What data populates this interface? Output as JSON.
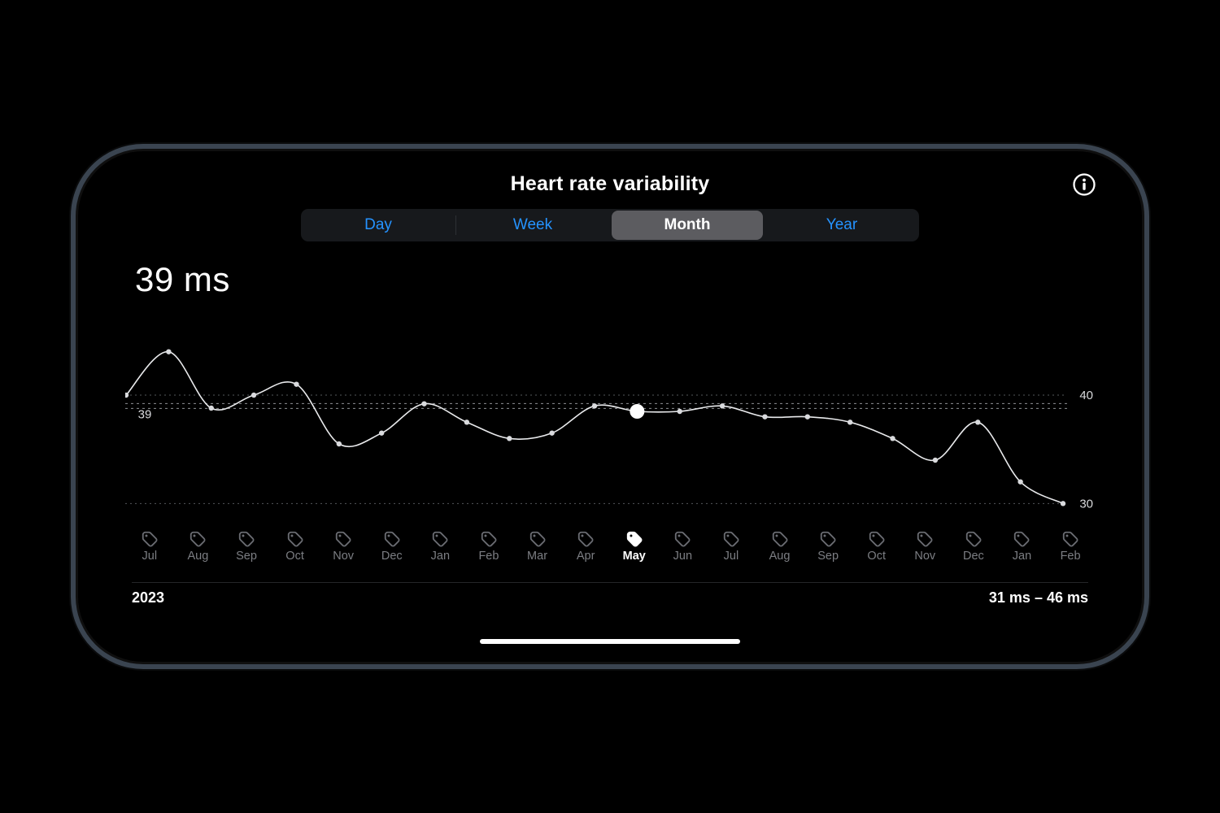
{
  "header": {
    "title": "Heart rate variability"
  },
  "segments": {
    "options": [
      "Day",
      "Week",
      "Month",
      "Year"
    ],
    "active_index": 2
  },
  "metric": {
    "value_label": "39 ms"
  },
  "footer": {
    "year": "2023",
    "range": "31 ms – 46 ms"
  },
  "chart_axis": {
    "yticks": [
      {
        "label": "40",
        "value": 40
      },
      {
        "label": "30",
        "value": 30
      }
    ],
    "selected_baseline": {
      "label": "39",
      "value": 39
    }
  },
  "chart_data": {
    "type": "line",
    "title": "Heart rate variability",
    "ylabel": "ms",
    "xlabel": "Month",
    "ylim": [
      28,
      46
    ],
    "categories": [
      "Jul",
      "Aug",
      "Sep",
      "Oct",
      "Nov",
      "Dec",
      "Jan",
      "Feb",
      "Mar",
      "Apr",
      "May",
      "Jun",
      "Jul",
      "Aug",
      "Sep",
      "Oct",
      "Nov",
      "Dec",
      "Jan",
      "Feb"
    ],
    "selected_category_index": 10,
    "series": [
      {
        "name": "HRV",
        "values": [
          40.0,
          44.0,
          38.8,
          40.0,
          41.0,
          35.5,
          36.5,
          39.2,
          37.5,
          36.0,
          36.5,
          39.0,
          38.5,
          38.5,
          39.0,
          38.0,
          38.0,
          37.5,
          36.0,
          34.0,
          37.5,
          32.0,
          30.0
        ]
      }
    ]
  }
}
